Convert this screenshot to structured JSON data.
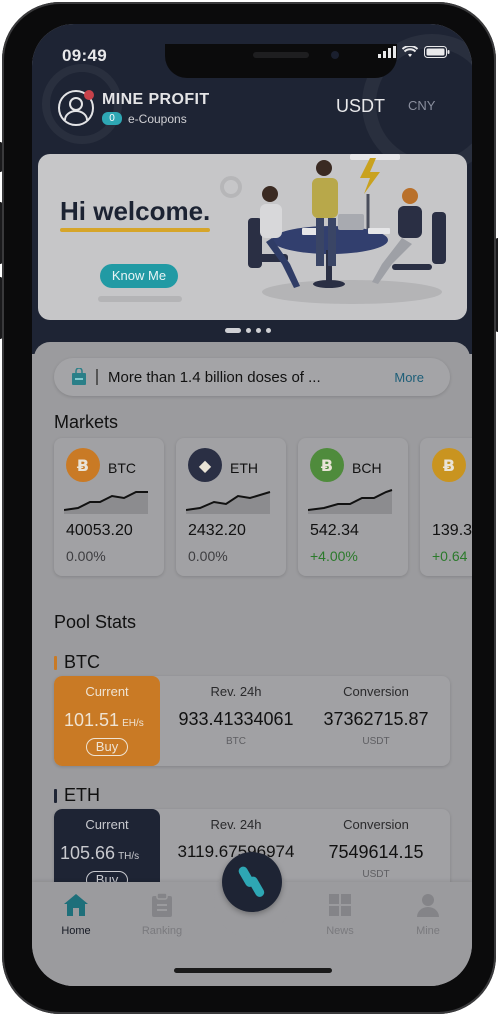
{
  "status": {
    "time": "09:49"
  },
  "profile": {
    "name": "MINE PROFIT",
    "coupon_count": "0",
    "coupon_label": "e-Coupons"
  },
  "currency": {
    "active": "USDT",
    "other": "CNY"
  },
  "banner": {
    "title": "Hi welcome.",
    "button": "Know Me"
  },
  "notice": {
    "text": "More than 1.4 billion doses of ...",
    "more": "More"
  },
  "markets": {
    "title": "Markets",
    "items": [
      {
        "symbol": "BTC",
        "price": "40053.20",
        "change": "0.00%",
        "color": "#c97a25"
      },
      {
        "symbol": "ETH",
        "price": "2432.20",
        "change": "0.00%",
        "color": "#2a2f44"
      },
      {
        "symbol": "BCH",
        "price": "542.34",
        "change": "+4.00%",
        "color": "#4f8b3c"
      },
      {
        "symbol": "",
        "price": "139.3",
        "change": "+0.64",
        "color": "#c99420"
      }
    ]
  },
  "pool": {
    "title": "Pool Stats",
    "rows": [
      {
        "coin": "BTC",
        "current_label": "Current",
        "current_value": "101.51",
        "unit": "EH/s",
        "buy": "Buy",
        "rev_label": "Rev. 24h",
        "rev_value": "933.41334061",
        "rev_unit": "BTC",
        "conv_label": "Conversion",
        "conv_value": "37362715.87",
        "conv_unit": "USDT",
        "accent": "#c97a25"
      },
      {
        "coin": "ETH",
        "current_label": "Current",
        "current_value": "105.66",
        "unit": "TH/s",
        "buy": "Buy",
        "rev_label": "Rev. 24h",
        "rev_value": "3119.67596974",
        "rev_unit": "",
        "conv_label": "Conversion",
        "conv_value": "7549614.15",
        "conv_unit": "USDT",
        "accent": "#1e2434"
      }
    ]
  },
  "tabs": [
    {
      "label": "Home",
      "icon": "home-icon"
    },
    {
      "label": "Ranking",
      "icon": "clipboard-icon"
    },
    {
      "label": "News",
      "icon": "grid-icon"
    },
    {
      "label": "Mine",
      "icon": "person-icon"
    }
  ]
}
